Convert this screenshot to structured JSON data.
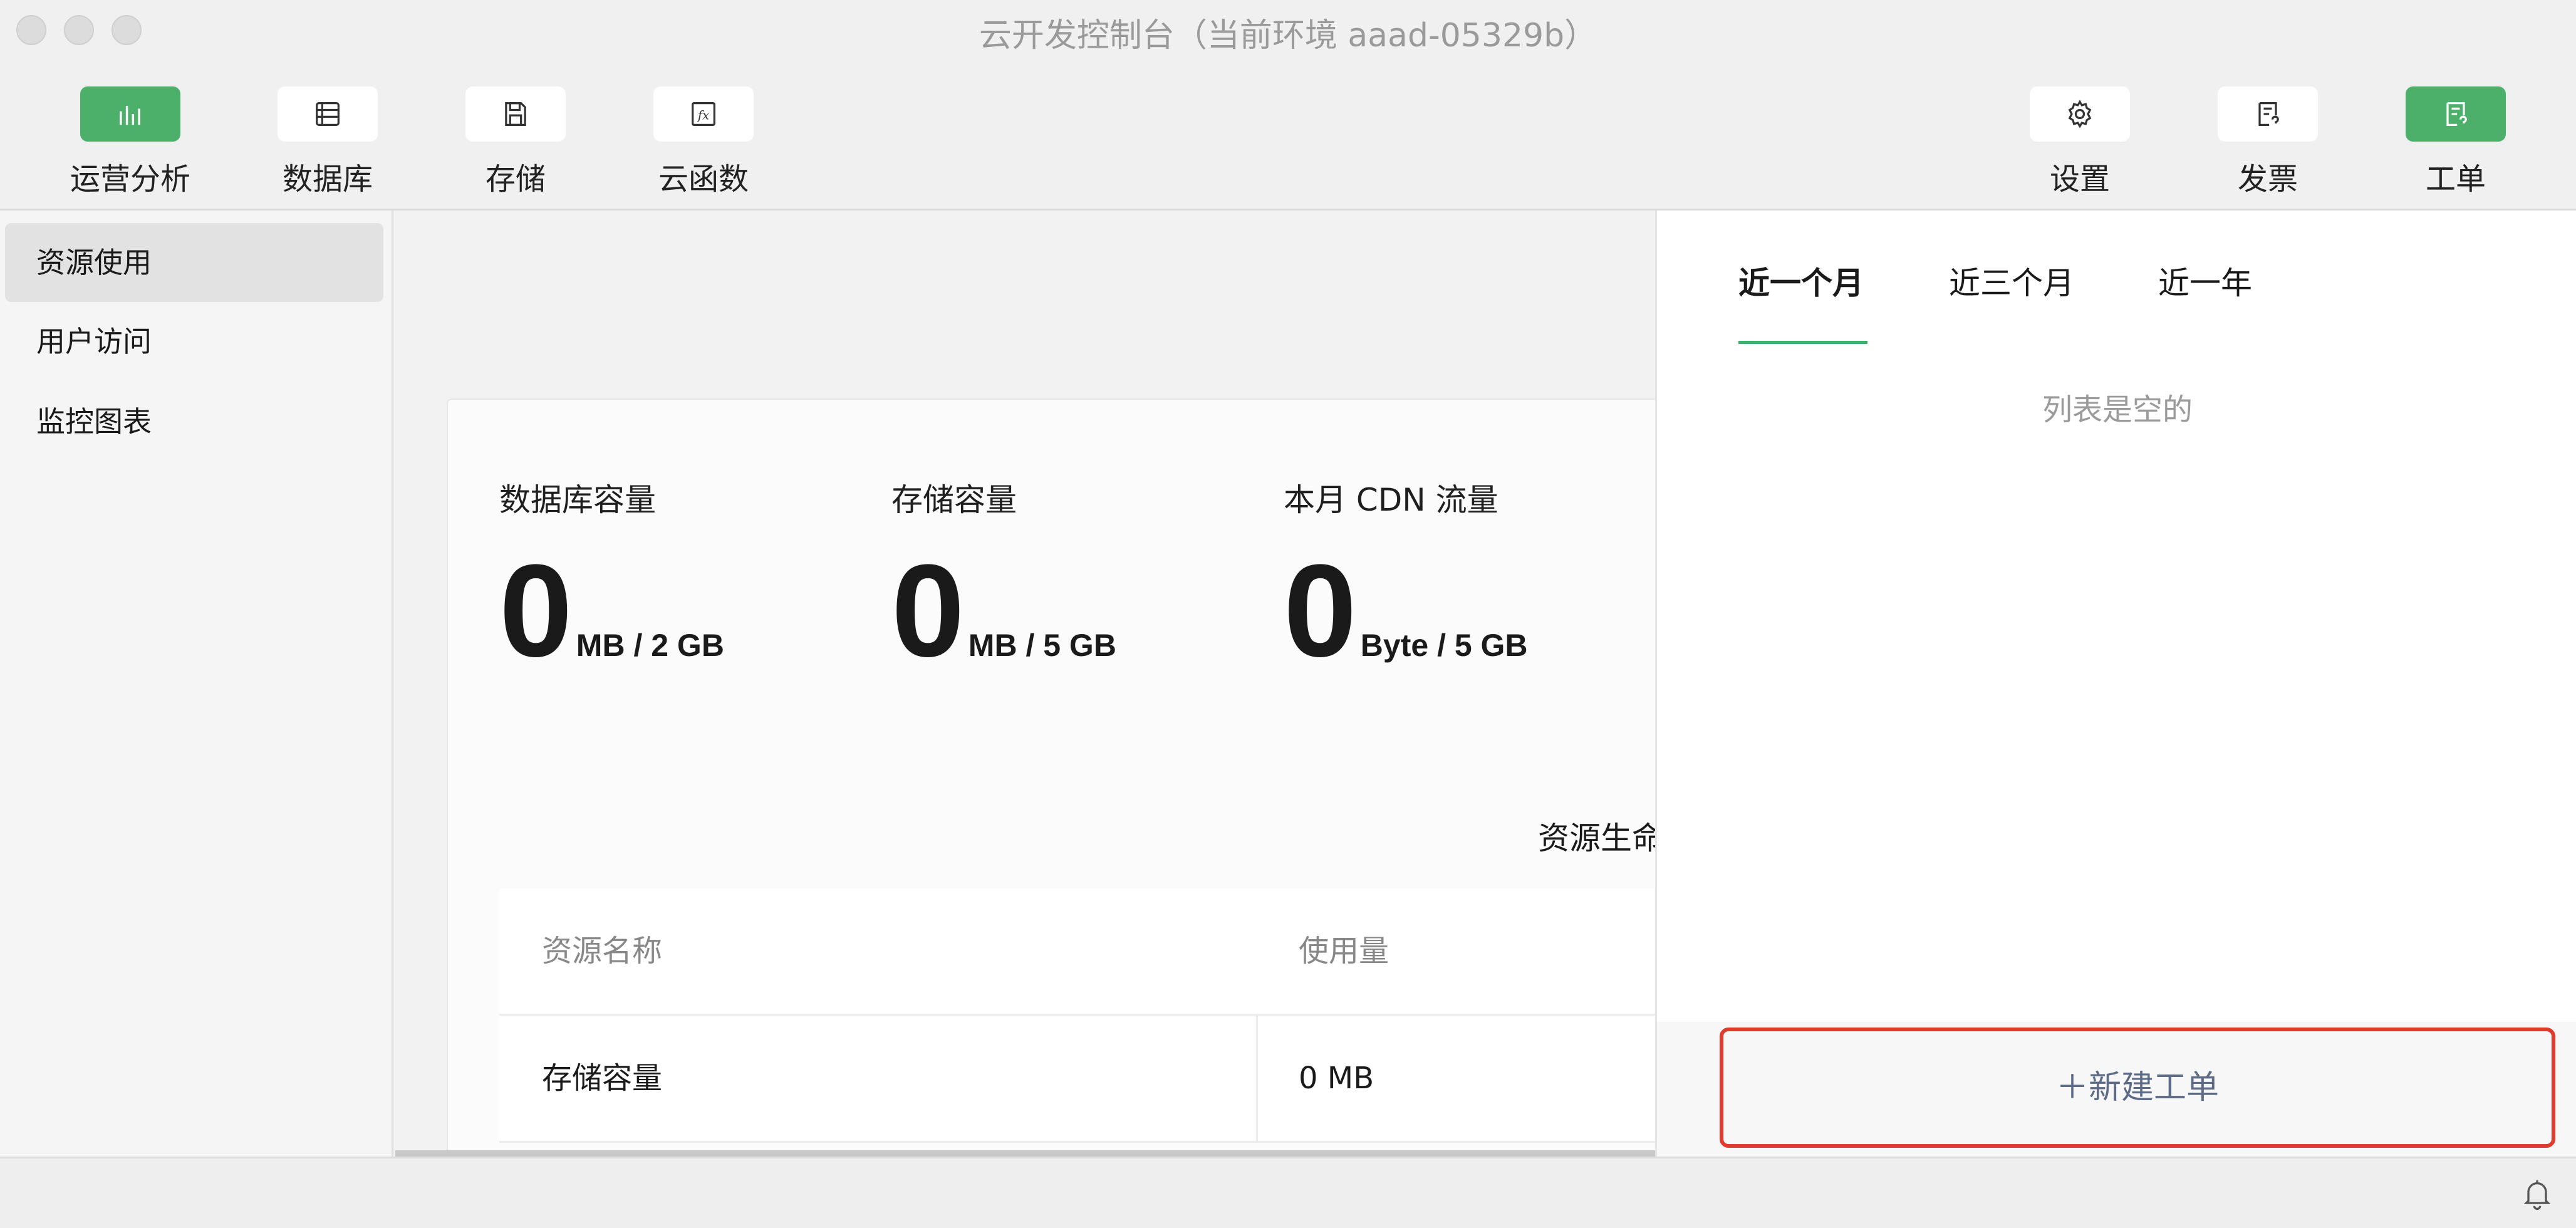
{
  "window": {
    "title": "云开发控制台（当前环境 aaad-05329b）"
  },
  "toolbar": {
    "left": [
      {
        "label": "运营分析",
        "icon": "bar-chart-icon",
        "active": true
      },
      {
        "label": "数据库",
        "icon": "database-icon",
        "active": false
      },
      {
        "label": "存储",
        "icon": "save-icon",
        "active": false
      },
      {
        "label": "云函数",
        "icon": "function-icon",
        "active": false
      }
    ],
    "right": [
      {
        "label": "设置",
        "icon": "gear-icon",
        "active": false
      },
      {
        "label": "发票",
        "icon": "invoice-icon",
        "active": false
      },
      {
        "label": "工单",
        "icon": "ticket-icon",
        "active": true
      }
    ]
  },
  "sidebar": {
    "items": [
      {
        "label": "资源使用",
        "active": true
      },
      {
        "label": "用户访问",
        "active": false
      },
      {
        "label": "监控图表",
        "active": false
      }
    ]
  },
  "stats": [
    {
      "title": "数据库容量",
      "value": "0",
      "unit": "MB / 2 GB"
    },
    {
      "title": "存储容量",
      "value": "0",
      "unit": "MB / 5 GB"
    },
    {
      "title": "本月 CDN 流量",
      "value": "0",
      "unit": "Byte / 5 GB"
    }
  ],
  "lifecycle_label": "资源生命",
  "table": {
    "headers": [
      "资源名称",
      "使用量"
    ],
    "rows": [
      [
        "存储容量",
        "0 MB"
      ]
    ]
  },
  "panel": {
    "tabs": [
      "近一个月",
      "近三个月",
      "近一年"
    ],
    "active_tab": 0,
    "empty_text": "列表是空的",
    "new_ticket_label": "＋新建工单"
  },
  "colors": {
    "accent": "#4caf6a",
    "highlight": "#e03c2e",
    "tab_underline": "#3cae6e"
  }
}
